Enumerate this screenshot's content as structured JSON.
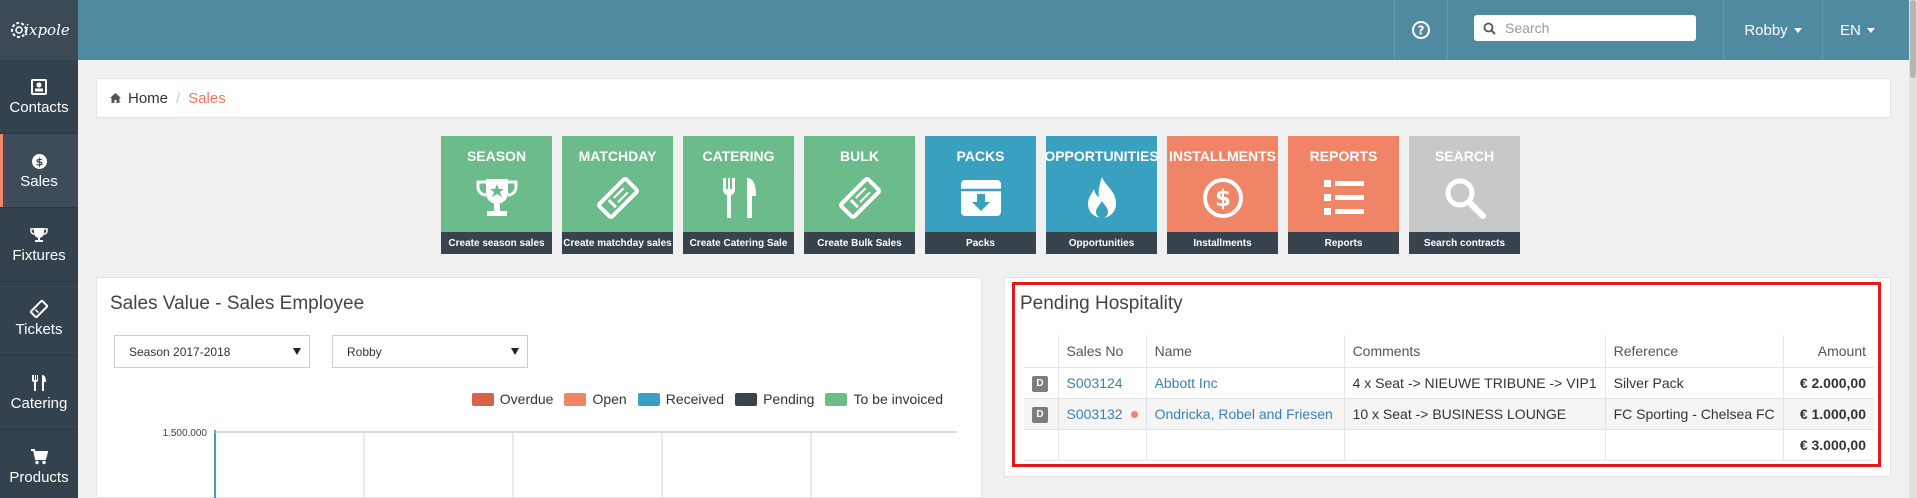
{
  "app": {
    "logo_text": "ixpole"
  },
  "sidebar": {
    "items": [
      {
        "label": "Contacts",
        "icon": "contacts-icon",
        "active": false
      },
      {
        "label": "Sales",
        "icon": "dollar-icon",
        "active": true
      },
      {
        "label": "Fixtures",
        "icon": "trophy-icon",
        "active": false
      },
      {
        "label": "Tickets",
        "icon": "ticket-icon",
        "active": false
      },
      {
        "label": "Catering",
        "icon": "cutlery-icon",
        "active": false
      },
      {
        "label": "Products",
        "icon": "cart-icon",
        "active": false
      }
    ]
  },
  "topbar": {
    "search_placeholder": "Search",
    "user": "Robby",
    "language": "EN"
  },
  "breadcrumb": {
    "home": "Home",
    "separator": "/",
    "current": "Sales"
  },
  "tiles": [
    {
      "title": "SEASON",
      "footer": "Create season sales",
      "color": "#6cbb8a",
      "icon": "trophy-icon"
    },
    {
      "title": "MATCHDAY",
      "footer": "Create matchday sales",
      "color": "#6cbb8a",
      "icon": "ticket-icon"
    },
    {
      "title": "CATERING",
      "footer": "Create Catering Sale",
      "color": "#6cbb8a",
      "icon": "cutlery-icon"
    },
    {
      "title": "BULK",
      "footer": "Create Bulk Sales",
      "color": "#6cbb8a",
      "icon": "ticket-icon"
    },
    {
      "title": "PACKS",
      "footer": "Packs",
      "color": "#3aa0bf",
      "icon": "archive-icon"
    },
    {
      "title": "OPPORTUNITIES",
      "footer": "Opportunities",
      "color": "#3aa0bf",
      "icon": "fire-icon"
    },
    {
      "title": "INSTALLMENTS",
      "footer": "Installments",
      "color": "#f08466",
      "icon": "dollar-circle-icon"
    },
    {
      "title": "REPORTS",
      "footer": "Reports",
      "color": "#f08466",
      "icon": "list-icon"
    },
    {
      "title": "SEARCH",
      "footer": "Search contracts",
      "color": "#c8c8c8",
      "icon": "search-icon"
    }
  ],
  "sales_value": {
    "title": "Sales Value - Sales Employee",
    "season_select": "Season 2017-2018",
    "employee_select": "Robby",
    "legend": [
      {
        "label": "Overdue",
        "color": "#d9604c"
      },
      {
        "label": "Open",
        "color": "#f08466"
      },
      {
        "label": "Received",
        "color": "#3aa0bf"
      },
      {
        "label": "Pending",
        "color": "#37444e"
      },
      {
        "label": "To be invoiced",
        "color": "#6cbb8a"
      }
    ],
    "chart_data": {
      "type": "bar",
      "y_tick_labels": [
        "1.500.000"
      ],
      "series": [
        {
          "name": "Overdue"
        },
        {
          "name": "Open"
        },
        {
          "name": "Received"
        },
        {
          "name": "Pending"
        },
        {
          "name": "To be invoiced"
        }
      ]
    }
  },
  "pending_hospitality": {
    "title": "Pending Hospitality",
    "columns": [
      "",
      "Sales No",
      "Name",
      "Comments",
      "Reference",
      "Amount"
    ],
    "rows": [
      {
        "badge": "D",
        "sales_no": "S003124",
        "name": "Abbott Inc",
        "comments": "4 x Seat -> NIEUWE TRIBUNE -> VIP1",
        "reference": "Silver Pack",
        "amount": "€ 2.000,00",
        "dot": false
      },
      {
        "badge": "D",
        "sales_no": "S003132",
        "name": "Ondricka, Robel and Friesen",
        "comments": "10 x Seat -> BUSINESS LOUNGE",
        "reference": "FC Sporting - Chelsea FC",
        "amount": "€ 1.000,00",
        "dot": true
      }
    ],
    "total": "€ 3.000,00"
  },
  "colors": {
    "topbar": "#4f8aa1",
    "sidebar": "#33424d",
    "accent": "#f0765a",
    "highlight": "#e21b1b"
  }
}
